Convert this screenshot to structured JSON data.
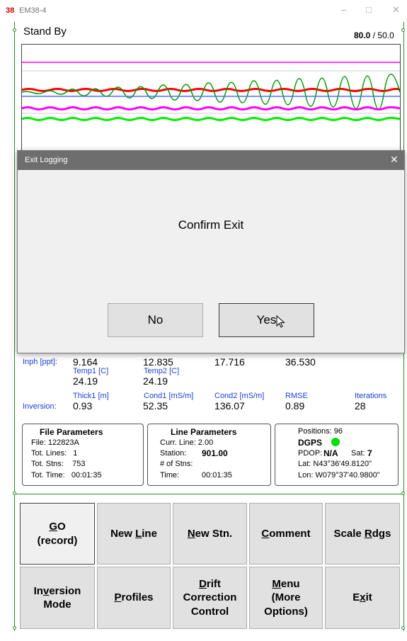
{
  "window": {
    "title": "EM38-4",
    "icon_text": "38",
    "minimize": "–",
    "maximize": "□",
    "close": "✕"
  },
  "status": "Stand By",
  "readout": {
    "value": "80.0",
    "sep": "/",
    "max": "50.0"
  },
  "plot": {
    "series_colors": [
      "#ff00ff",
      "#333333",
      "#ff0000",
      "#00e000",
      "#6e8bff",
      "#ff00ff",
      "#00dd00"
    ]
  },
  "dialog": {
    "title": "Exit Logging",
    "close": "✕",
    "message": "Confirm Exit",
    "no_label": "No",
    "yes_label": "Yes"
  },
  "inph": {
    "label": "Inph [ppt]:",
    "values": [
      "9.164",
      "12.835",
      "17.716",
      "36.530"
    ]
  },
  "temps": [
    {
      "label": "Temp1 [C]",
      "value": "24.19"
    },
    {
      "label": "Temp2 [C]",
      "value": "24.19"
    }
  ],
  "inversion": {
    "label": "Inversion:",
    "cols": [
      {
        "label": "Thick1 [m]",
        "value": "0.93"
      },
      {
        "label": "Cond1 [mS/m]",
        "value": "52.35"
      },
      {
        "label": "Cond2 [mS/m]",
        "value": "136.07"
      },
      {
        "label": "RMSE",
        "value": "0.89"
      },
      {
        "label": "Iterations",
        "value": "28"
      }
    ]
  },
  "file_params": {
    "title": "File Parameters",
    "file": "File: 122823A",
    "lines": "Tot. Lines:   1",
    "stns": "Tot. Stns:    753",
    "time": "Tot. Time:   00:01:35"
  },
  "line_params": {
    "title": "Line Parameters",
    "curr_line": "Curr. Line: 2.00",
    "station_label": "Station:",
    "station_value": "901.00",
    "num_stns": "# of Stns:",
    "time_label": "Time:",
    "time_value": "00:01:35"
  },
  "gps": {
    "positions": "Positions: 96",
    "dgps": "DGPS",
    "pdop_label": "PDOP:",
    "pdop_value": "N/A",
    "sat_label": "Sat:",
    "sat_value": "7",
    "lat": "Lat:  N43°36'49.8120\"",
    "lon": "Lon: W079°37'40.9800\"",
    "indicator_color": "#00dd00"
  },
  "buttons": {
    "go": {
      "key": "G",
      "rest": "O",
      "line2": "(record)"
    },
    "new_line": {
      "pre": "New ",
      "key": "L",
      "post": "ine"
    },
    "new_stn": {
      "pre": "",
      "key": "N",
      "post": "ew Stn."
    },
    "comment": {
      "pre": "",
      "key": "C",
      "post": "omment"
    },
    "scale": {
      "pre": "Scale ",
      "key": "R",
      "post": "dgs"
    },
    "inversion": {
      "pre": "In",
      "key": "v",
      "post": "ersion",
      "line2": "Mode"
    },
    "profiles": {
      "pre": "",
      "key": "P",
      "post": "rofiles"
    },
    "drift": {
      "key": "D",
      "post": "rift",
      "line2": "Correction",
      "line3": "Control"
    },
    "menu": {
      "key": "M",
      "post": "enu",
      "line2": "(More",
      "line3": "Options)"
    },
    "exit": {
      "pre": "E",
      "key": "x",
      "post": "it"
    }
  }
}
